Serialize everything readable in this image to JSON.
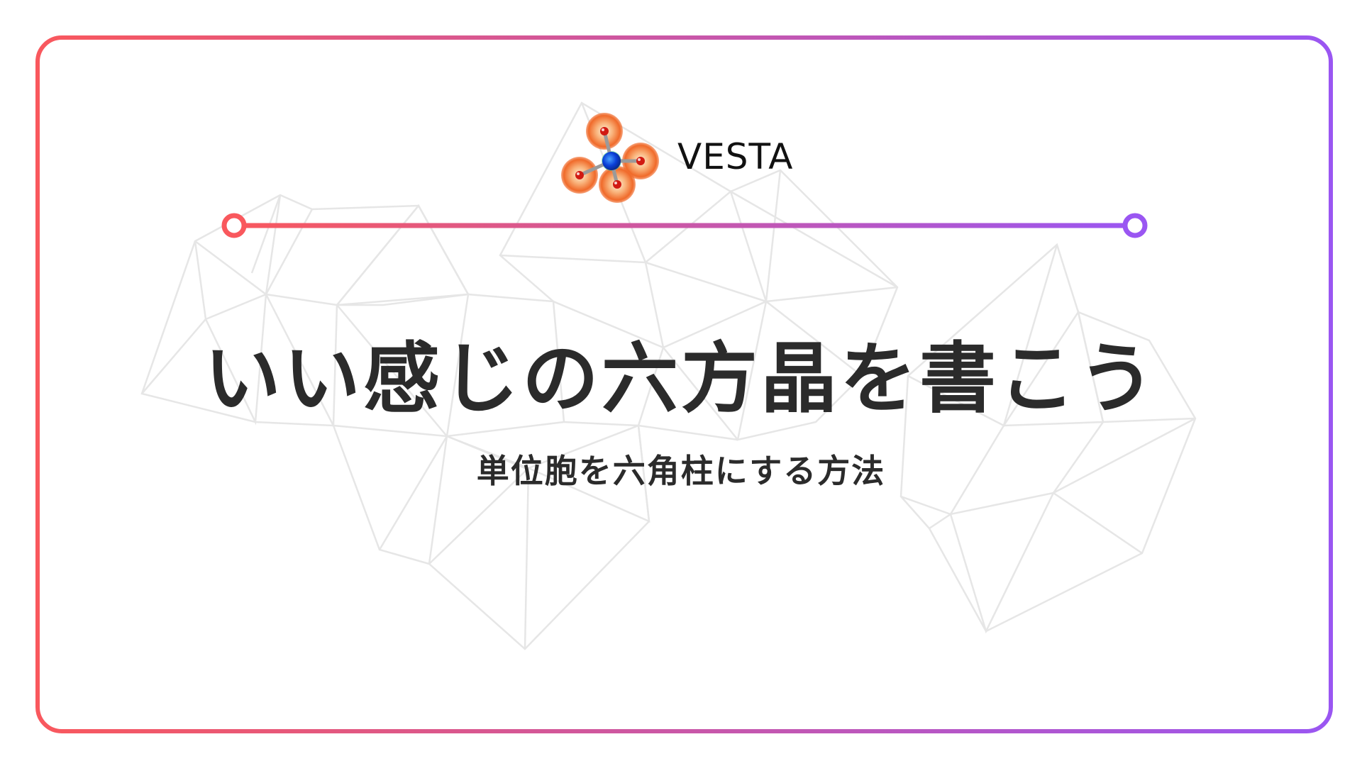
{
  "brand": {
    "name": "VESTA",
    "logo_icon": "molecule-icon"
  },
  "title": "いい感じの六方晶を書こう",
  "subtitle": "単位胞を六角柱にする方法",
  "colors": {
    "gradient_start": "#f9585d",
    "gradient_end": "#9a56f2",
    "text": "#2b2b2b",
    "mesh": "#e4e4e4"
  }
}
